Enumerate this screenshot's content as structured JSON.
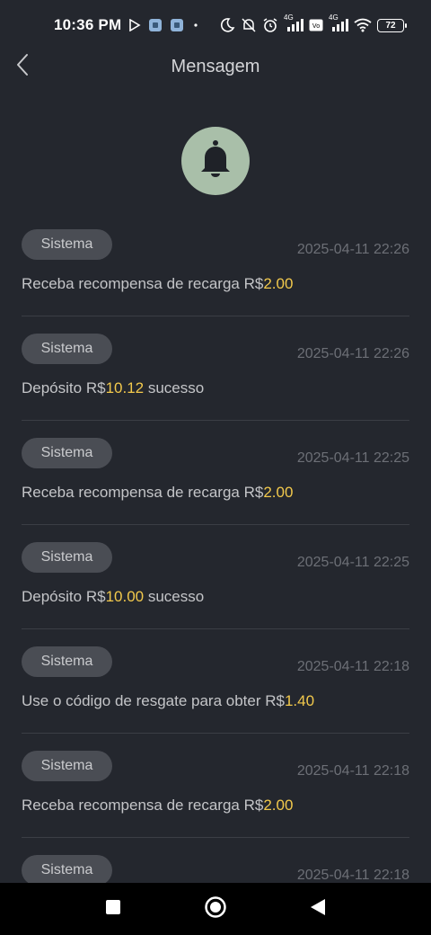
{
  "status_bar": {
    "time": "10:36 PM",
    "network_1": "4G",
    "network_2": "4G",
    "battery": "72"
  },
  "header": {
    "title": "Mensagem"
  },
  "messages": [
    {
      "badge": "Sistema",
      "time": "2025-04-11 22:26",
      "prefix": "Receba recompensa de recarga R$",
      "amount": "2.00",
      "suffix": ""
    },
    {
      "badge": "Sistema",
      "time": "2025-04-11 22:26",
      "prefix": "Depósito R$",
      "amount": "10.12",
      "suffix": " sucesso"
    },
    {
      "badge": "Sistema",
      "time": "2025-04-11 22:25",
      "prefix": "Receba recompensa de recarga R$",
      "amount": "2.00",
      "suffix": ""
    },
    {
      "badge": "Sistema",
      "time": "2025-04-11 22:25",
      "prefix": "Depósito R$",
      "amount": "10.00",
      "suffix": " sucesso"
    },
    {
      "badge": "Sistema",
      "time": "2025-04-11 22:18",
      "prefix": "Use o código de resgate para obter R$",
      "amount": "1.40",
      "suffix": ""
    },
    {
      "badge": "Sistema",
      "time": "2025-04-11 22:18",
      "prefix": "Receba recompensa de recarga R$",
      "amount": "2.00",
      "suffix": ""
    },
    {
      "badge": "Sistema",
      "time": "2025-04-11 22:18",
      "prefix": "",
      "amount": "",
      "suffix": ""
    }
  ],
  "colors": {
    "background": "#24272e",
    "amount_accent": "#f2c94c",
    "bell_circle": "#a9bfa9"
  },
  "icons": {
    "back": "chevron-left-icon",
    "bell": "bell-icon",
    "nav_recent": "square-icon",
    "nav_home": "circle-icon",
    "nav_back": "triangle-back-icon"
  }
}
